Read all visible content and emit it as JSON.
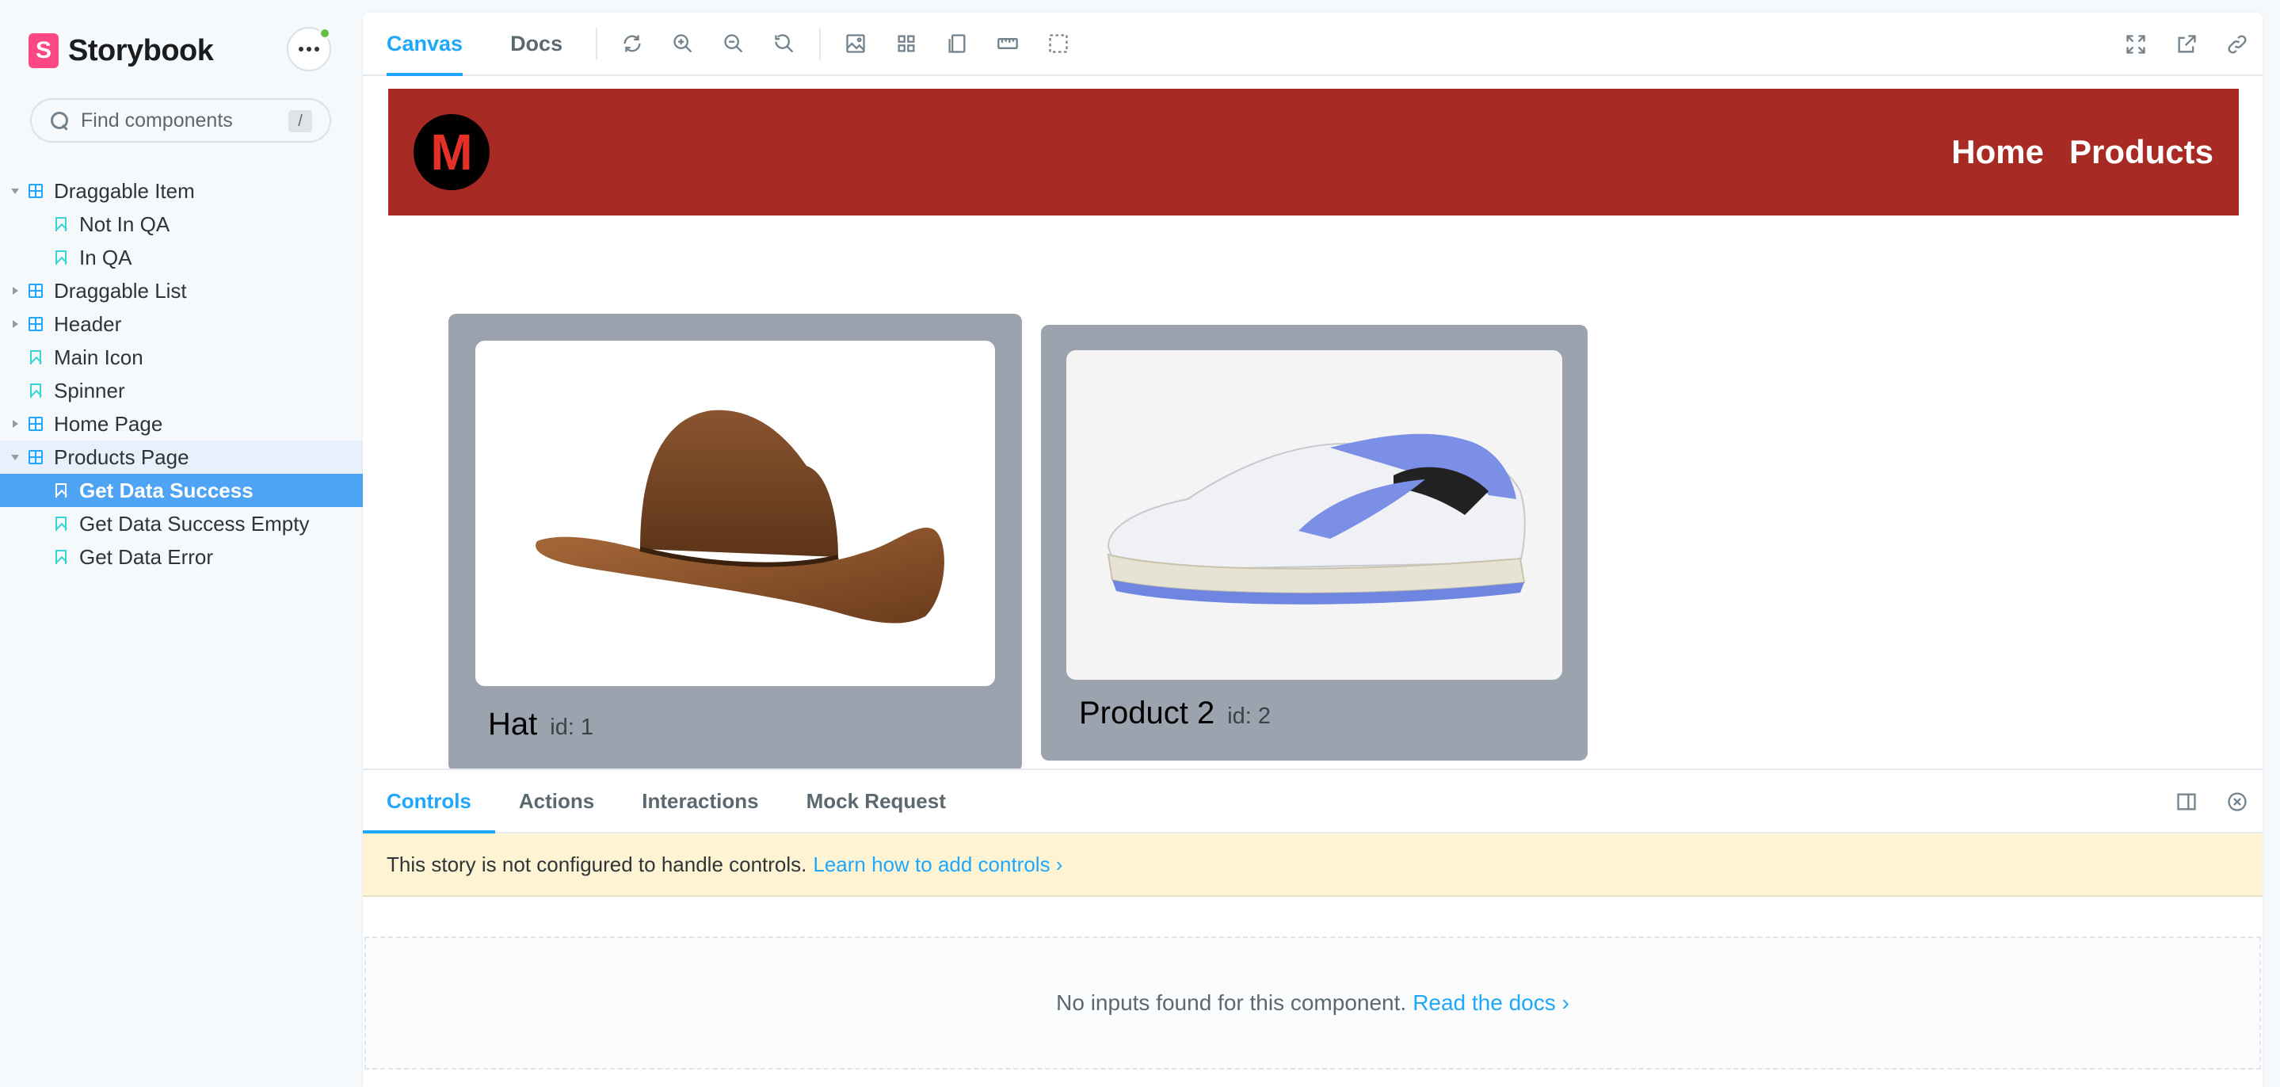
{
  "sidebar": {
    "brand": {
      "logo_letter": "S",
      "name": "Storybook"
    },
    "search": {
      "placeholder": "Find components",
      "shortcut": "/"
    },
    "tree": [
      {
        "label": "Draggable Item",
        "kind": "component",
        "caret": "down"
      },
      {
        "label": "Not In QA",
        "kind": "story"
      },
      {
        "label": "In QA",
        "kind": "story"
      },
      {
        "label": "Draggable List",
        "kind": "component",
        "caret": "right"
      },
      {
        "label": "Header",
        "kind": "component",
        "caret": "right"
      },
      {
        "label": "Main Icon",
        "kind": "story"
      },
      {
        "label": "Spinner",
        "kind": "story"
      },
      {
        "label": "Home Page",
        "kind": "component",
        "caret": "right"
      },
      {
        "label": "Products Page",
        "kind": "component",
        "caret": "down"
      },
      {
        "label": "Get Data Success",
        "kind": "story",
        "selected": true
      },
      {
        "label": "Get Data Success Empty",
        "kind": "story"
      },
      {
        "label": "Get Data Error",
        "kind": "story"
      }
    ]
  },
  "toolbar": {
    "tabs": [
      {
        "label": "Canvas",
        "active": true
      },
      {
        "label": "Docs"
      }
    ],
    "left_icons": [
      "reload-icon",
      "zoom-in-icon",
      "zoom-out-icon",
      "zoom-reset-icon",
      "background-icon",
      "grid-icon",
      "viewport-icon",
      "measure-icon",
      "outline-icon"
    ],
    "right_icons": [
      "fullscreen-icon",
      "open-new-tab-icon",
      "copy-link-icon"
    ]
  },
  "preview": {
    "header": {
      "logo_letter": "M",
      "nav": [
        "Home",
        "Products"
      ],
      "color": "#a82a24"
    },
    "products": [
      {
        "name": "Hat",
        "id_label": "id: 1",
        "image": "cowboy-hat"
      },
      {
        "name": "Product 2",
        "id_label": "id: 2",
        "image": "sneaker"
      }
    ]
  },
  "addons": {
    "tabs": [
      {
        "label": "Controls",
        "active": true
      },
      {
        "label": "Actions"
      },
      {
        "label": "Interactions"
      },
      {
        "label": "Mock Request"
      }
    ],
    "warning": {
      "text": "This story is not configured to handle controls.",
      "link": "Learn how to add controls ›"
    },
    "empty": {
      "text": "No inputs found for this component.",
      "link": "Read the docs ›"
    }
  },
  "colors": {
    "accent": "#1ea7fd",
    "selected": "#4fa3f4",
    "storybook_pink": "#ff4785"
  }
}
